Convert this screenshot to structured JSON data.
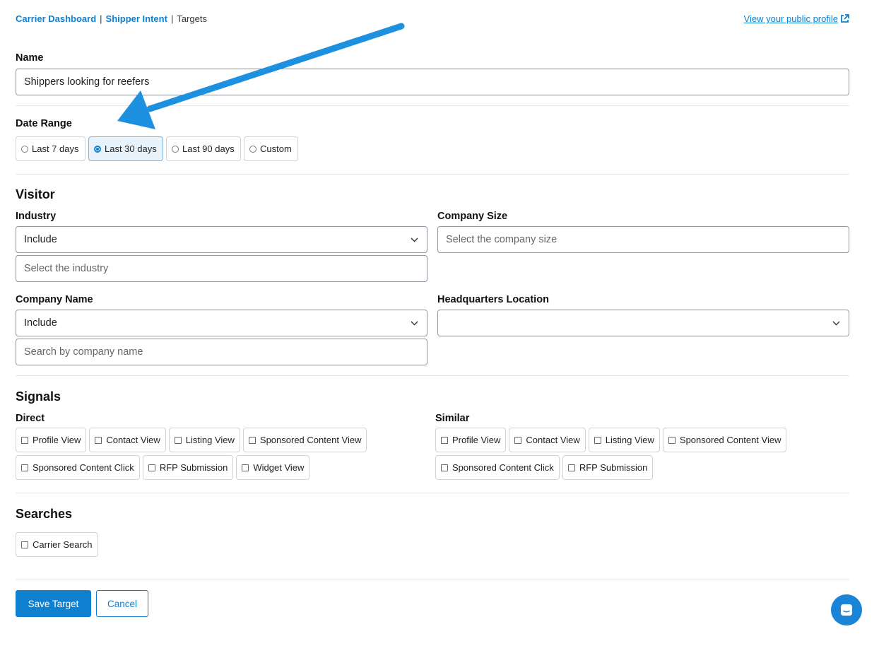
{
  "breadcrumb": {
    "items": [
      "Carrier Dashboard",
      "Shipper Intent"
    ],
    "separator": "|",
    "current": "Targets"
  },
  "public_profile_link": "View your public profile",
  "name": {
    "label": "Name",
    "value": "Shippers looking for reefers"
  },
  "date_range": {
    "label": "Date Range",
    "options": [
      "Last 7 days",
      "Last 30 days",
      "Last 90 days",
      "Custom"
    ],
    "selected": "Last 30 days"
  },
  "visitor": {
    "heading": "Visitor",
    "industry": {
      "label": "Industry",
      "mode": "Include",
      "placeholder": "Select the industry"
    },
    "company_size": {
      "label": "Company Size",
      "placeholder": "Select the company size"
    },
    "company_name": {
      "label": "Company Name",
      "mode": "Include",
      "placeholder": "Search by company name"
    },
    "hq_location": {
      "label": "Headquarters Location",
      "value": ""
    }
  },
  "signals": {
    "heading": "Signals",
    "direct": {
      "label": "Direct",
      "row1": [
        "Profile View",
        "Contact View",
        "Listing View",
        "Sponsored Content View"
      ],
      "row2": [
        "Sponsored Content Click",
        "RFP Submission",
        "Widget View"
      ]
    },
    "similar": {
      "label": "Similar",
      "row1": [
        "Profile View",
        "Contact View",
        "Listing View",
        "Sponsored Content View"
      ],
      "row2": [
        "Sponsored Content Click",
        "RFP Submission"
      ]
    }
  },
  "searches": {
    "heading": "Searches",
    "options": [
      "Carrier Search"
    ]
  },
  "actions": {
    "save": "Save Target",
    "cancel": "Cancel"
  },
  "colors": {
    "accent": "#0f7fcf",
    "annotation_arrow": "#1e90e0",
    "chat": "#1a84d6"
  },
  "icons": {
    "external_link": "external-link-icon",
    "chevron": "chevron-down-icon",
    "chat": "chat-icon"
  }
}
